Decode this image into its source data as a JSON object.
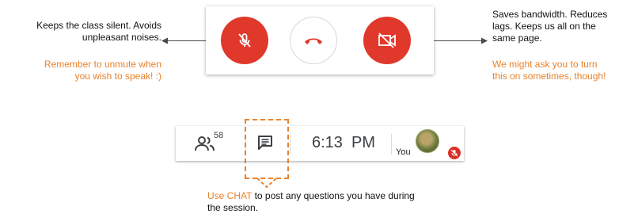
{
  "left_note": {
    "line1": "Keeps the class silent. Avoids",
    "line2": "unpleasant noises.",
    "tip_line1": "Remember to unmute  when",
    "tip_line2": "you wish to speak! :)"
  },
  "right_note": {
    "line1": "Saves bandwidth.  Reduces",
    "line2": "lags. Keeps us all on the",
    "line3": "same page.",
    "tip_line1": "We might ask you to turn",
    "tip_line2": "this on sometimes, though!"
  },
  "controls": {
    "mic_button": {
      "icon": "mic-off-icon",
      "state": "muted"
    },
    "hangup_button": {
      "icon": "phone-hangup-icon"
    },
    "camera_button": {
      "icon": "videocam-off-icon",
      "state": "off"
    }
  },
  "bottom_bar": {
    "participants_icon": "people-icon",
    "participant_count": "58",
    "chat_icon": "chat-icon",
    "time": "6:13  PM",
    "you_label": "You",
    "avatar_icon": "avatar",
    "mic_status_icon": "mic-off-icon"
  },
  "chat_note": {
    "highlight": "Use CHAT",
    "rest_line1": " to post any questions you have during",
    "line2": "the session."
  },
  "colors": {
    "accent_red": "#e0392c",
    "annotation_orange": "#e8822a",
    "text_dark": "#111111"
  }
}
